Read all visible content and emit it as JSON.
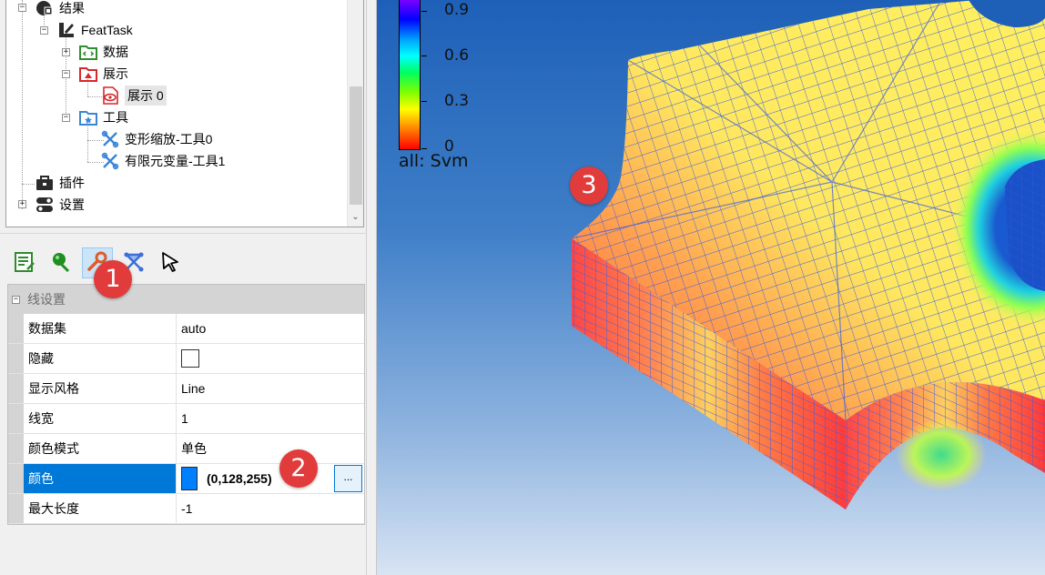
{
  "tree": {
    "items": [
      {
        "label": "结果",
        "icon": "results-icon",
        "expander": "−"
      },
      {
        "label": "FeatTask",
        "icon": "feattask-icon",
        "expander": "−"
      },
      {
        "label": "数据",
        "icon": "data-folder-icon",
        "expander": "+"
      },
      {
        "label": "展示",
        "icon": "display-folder-icon",
        "expander": "−"
      },
      {
        "label": "展示 0",
        "icon": "display-item-icon",
        "expander": ""
      },
      {
        "label": "工具",
        "icon": "tools-folder-icon",
        "expander": "−"
      },
      {
        "label": "变形缩放-工具0",
        "icon": "tool-item-icon",
        "expander": ""
      },
      {
        "label": "有限元变量-工具1",
        "icon": "tool-item-icon",
        "expander": ""
      },
      {
        "label": "插件",
        "icon": "plugin-icon",
        "expander": ""
      },
      {
        "label": "设置",
        "icon": "settings-toggle-icon",
        "expander": "+"
      }
    ],
    "scroll_down": "⌄"
  },
  "toolbar": {
    "buttons": [
      {
        "name": "properties-list-icon",
        "color": "#2e8b2e"
      },
      {
        "name": "color-pin-icon",
        "color": "#1f8f1f"
      },
      {
        "name": "line-settings-icon",
        "color": "#e05a2a",
        "active": true
      },
      {
        "name": "mesh-nodes-icon",
        "color": "#3c6fd8"
      },
      {
        "name": "select-cursor-icon",
        "color": "#000000"
      }
    ]
  },
  "properties": {
    "group": {
      "label": "线设置",
      "expander": "−"
    },
    "rows": [
      {
        "name": "数据集",
        "value": "auto"
      },
      {
        "name": "隐藏",
        "value": "",
        "type": "checkbox",
        "checked": false
      },
      {
        "name": "显示风格",
        "value": "Line"
      },
      {
        "name": "线宽",
        "value": "1"
      },
      {
        "name": "颜色模式",
        "value": "单色"
      },
      {
        "name": "颜色",
        "value": "(0,128,255)",
        "type": "color",
        "color": "#0080ff",
        "button": "...",
        "selected": true
      },
      {
        "name": "最大长度",
        "value": "-1"
      }
    ]
  },
  "viewport": {
    "colorbar": {
      "title": "all: Svm",
      "ticks": [
        "0.9",
        "0.6",
        "0.3",
        "0"
      ]
    }
  },
  "callouts": [
    "1",
    "2",
    "3"
  ]
}
